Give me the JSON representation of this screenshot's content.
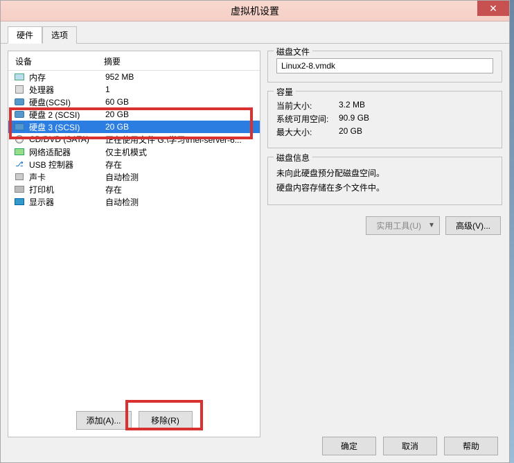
{
  "window": {
    "title": "虚拟机设置",
    "close_glyph": "✕"
  },
  "tabs": {
    "hardware": "硬件",
    "options": "选项"
  },
  "list_header": {
    "device": "设备",
    "summary": "摘要"
  },
  "devices": [
    {
      "icon": "mem",
      "name": "内存",
      "summary": "952 MB"
    },
    {
      "icon": "cpu",
      "name": "处理器",
      "summary": "1"
    },
    {
      "icon": "hdd",
      "name": "硬盘(SCSI)",
      "summary": "60 GB"
    },
    {
      "icon": "hdd",
      "name": "硬盘 2 (SCSI)",
      "summary": "20 GB"
    },
    {
      "icon": "hdd",
      "name": "硬盘 3 (SCSI)",
      "summary": "20 GB",
      "selected": true
    },
    {
      "icon": "cd",
      "name": "CD/DVD (SATA)",
      "summary": "正在使用文件 G:\\学习\\rhel-server-6..."
    },
    {
      "icon": "net",
      "name": "网络适配器",
      "summary": "仅主机模式"
    },
    {
      "icon": "usb",
      "name": "USB 控制器",
      "summary": "存在"
    },
    {
      "icon": "snd",
      "name": "声卡",
      "summary": "自动检测"
    },
    {
      "icon": "prn",
      "name": "打印机",
      "summary": "存在"
    },
    {
      "icon": "dsp",
      "name": "显示器",
      "summary": "自动检测"
    }
  ],
  "left_buttons": {
    "add": "添加(A)...",
    "remove": "移除(R)"
  },
  "right": {
    "disk_file_group": "磁盘文件",
    "disk_file_value": "Linux2-8.vmdk",
    "capacity_group": "容量",
    "current_size_k": "当前大小:",
    "current_size_v": "3.2 MB",
    "free_space_k": "系统可用空间:",
    "free_space_v": "90.9 GB",
    "max_size_k": "最大大小:",
    "max_size_v": "20 GB",
    "disk_info_group": "磁盘信息",
    "disk_info_line1": "未向此硬盘预分配磁盘空间。",
    "disk_info_line2": "硬盘内容存储在多个文件中。",
    "utilities_btn": "实用工具(U)",
    "advanced_btn": "高级(V)..."
  },
  "footer": {
    "ok": "确定",
    "cancel": "取消",
    "help": "帮助"
  }
}
